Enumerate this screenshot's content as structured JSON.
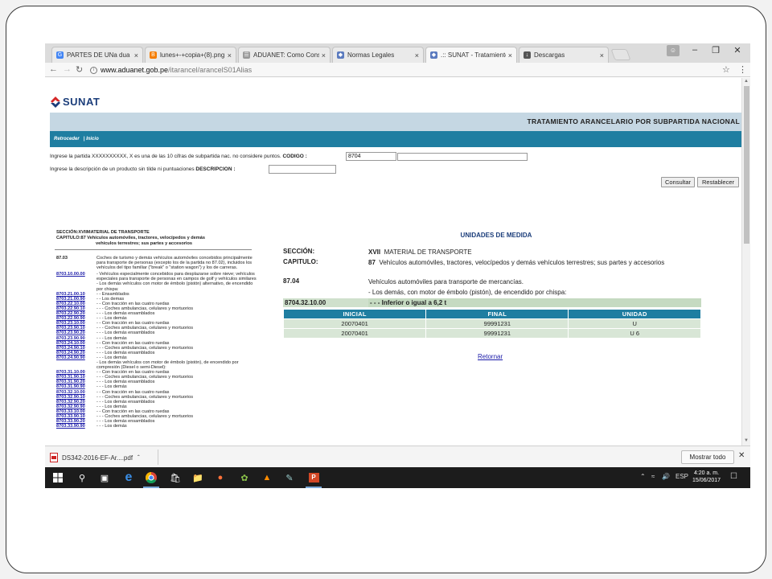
{
  "browser": {
    "tabs": [
      {
        "label": "PARTES DE UNa dua per",
        "icon": "google-icon",
        "color": "#4285f4"
      },
      {
        "label": "lunes+-+copia+(8).png",
        "icon": "blogger-icon",
        "color": "#f57d00"
      },
      {
        "label": "ADUANET: Como Conse",
        "icon": "page-icon",
        "color": "#999999"
      },
      {
        "label": "Normas Legales",
        "icon": "diamond-icon",
        "color": "#5b7bbf"
      },
      {
        "label": ".:: SUNAT - Tratamiento A",
        "icon": "diamond-icon",
        "color": "#5b7bbf"
      },
      {
        "label": "Descargas",
        "icon": "download-icon",
        "color": "#555555"
      }
    ],
    "address_host": "www.aduanet.gob.pe",
    "address_path": "/itarancel/arancelS01Alias"
  },
  "page": {
    "logo_text": "SUNAT",
    "header_title": "TRATAMIENTO ARANCELARIO POR SUBPARTIDA NACIONAL",
    "nav_back": "Retroceder",
    "nav_sep": "|",
    "nav_home": "Inicio",
    "form": {
      "codigo_hint": "Ingrese la partida XXXXXXXXXX, X es una de las 10 cifras de subpartida nac. no considere puntos.",
      "codigo_label": "CODIGO :",
      "codigo_value": "8704",
      "desc_hint": "Ingrese la descripción de un producto sin tilde ni puntuaciones",
      "desc_label": "DESCRIPCION :",
      "desc_value": "",
      "btn_consultar": "Consultar",
      "btn_restablecer": "Restablecer"
    },
    "left": {
      "seccion": "SECCIÓN:XVIIMATERIAL DE TRANSPORTE",
      "capitulo": "CAPITULO:87  Vehículos automóviles, tractores, velocípedos y demás",
      "capitulo_cont": "vehículos terrestres; sus partes y accesorios",
      "rows": [
        {
          "code": "87.03",
          "type": "bold",
          "desc": "Coches de turismo y demás vehículos automóviles concebidos principalmente para transporte de personas (excepto los de la partida no 87.02), incluidos los vehículos del tipo familiar (\"break\" o \"station wagon\") y los de carreras."
        },
        {
          "code": "8703.10.00.00",
          "type": "link",
          "desc": "- Vehículos especialmente concebidos para desplazarse sobre nieve; vehículos especiales para transporte de personas en campos de golf y vehículos similares"
        },
        {
          "code": "",
          "type": "plain",
          "desc": "- Los demás vehículos con motor de émbolo (pistón) alternativo, de encendido por chispa:"
        },
        {
          "code": "8703.21.00.10",
          "type": "link",
          "desc": "- - Ensamblados"
        },
        {
          "code": "8703.21.00.90",
          "type": "link",
          "desc": "- - Los demas"
        },
        {
          "code": "8703.22.10.00",
          "type": "link",
          "desc": "- - Con tracción en las cuatro ruedas"
        },
        {
          "code": "8703.22.90.10",
          "type": "link",
          "desc": "- - - Coches ambulancias, celulares y mortuorios"
        },
        {
          "code": "8703.22.90.20",
          "type": "link",
          "desc": "- - - Los demás ensamblados"
        },
        {
          "code": "8703.22.90.90",
          "type": "link",
          "desc": "- - - Los demás"
        },
        {
          "code": "8703.23.10.00",
          "type": "link",
          "desc": "- - Con tracción en las cuatro ruedas"
        },
        {
          "code": "8703.23.90.10",
          "type": "link",
          "desc": "- - - Coches ambulancias, celulares y mortuorios"
        },
        {
          "code": "8703.23.90.20",
          "type": "link",
          "desc": "- - - Los demás ensamblados"
        },
        {
          "code": "8703.23.90.90",
          "type": "link",
          "desc": "- - - Los demás"
        },
        {
          "code": "8703.24.10.00",
          "type": "link",
          "desc": "- - Con tracción en las cuatro ruedas"
        },
        {
          "code": "8703.24.90.10",
          "type": "link",
          "desc": "- - - Coches ambulancias, celulares y mortuorios"
        },
        {
          "code": "8703.24.90.20",
          "type": "link",
          "desc": "- - - Los demás ensamblados"
        },
        {
          "code": "8703.24.90.90",
          "type": "link",
          "desc": "- - - Los demás"
        },
        {
          "code": "",
          "type": "plain",
          "desc": "- Los demás vehículos con motor de émbolo (pistón), de encendido por compresión (Diesel o semi-Diesel):"
        },
        {
          "code": "8703.31.10.00",
          "type": "link",
          "desc": "- - Con tracción en las cuatro ruedas"
        },
        {
          "code": "8703.31.90.10",
          "type": "link",
          "desc": "- - - Coches ambulancias, celulares y mortuorios"
        },
        {
          "code": "8703.31.90.20",
          "type": "link",
          "desc": "- - - Los demás ensamblados"
        },
        {
          "code": "8703.31.90.90",
          "type": "link",
          "desc": "- - - Los demás"
        },
        {
          "code": "8703.32.10.00",
          "type": "link",
          "desc": "- - Con tracción en las cuatro ruedas"
        },
        {
          "code": "8703.32.90.10",
          "type": "link",
          "desc": "- - - Coches ambulancias, celulares y mortuorios"
        },
        {
          "code": "8703.32.90.20",
          "type": "link",
          "desc": "- - - Los demás ensamblados"
        },
        {
          "code": "8703.32.90.90",
          "type": "link",
          "desc": "- - - Los demás"
        },
        {
          "code": "8703.33.10.00",
          "type": "link",
          "desc": "- - Con tracción en las cuatro ruedas"
        },
        {
          "code": "8703.33.90.10",
          "type": "link",
          "desc": "- - - Coches ambulancias, celulares y mortuorios"
        },
        {
          "code": "8703.33.90.20",
          "type": "link",
          "desc": "- - - Los demás ensamblados"
        },
        {
          "code": "8703.33.90.90",
          "type": "link",
          "desc": "- - - Los demás"
        }
      ]
    },
    "right": {
      "title": "UNIDADES DE MEDIDA",
      "seccion_label": "SECCIÓN:",
      "seccion_num": "XVII",
      "seccion_text": "MATERIAL DE TRANSPORTE",
      "capitulo_label": "CAPITULO:",
      "capitulo_num": "87",
      "capitulo_text": "Vehículos automóviles, tractores, velocípedos y demás vehículos terrestres; sus partes y accesorios",
      "partida_code": "87.04",
      "partida_text": "Vehículos automóviles para transporte de mercancías.",
      "partida_sub": "- Los demás, con motor de émbolo (pistón), de encendido por chispa:",
      "sub_code": "8704.32.10.00",
      "sub_text": "- - - Inferior o igual a 6,2 t",
      "table_headers": [
        "INICIAL",
        "FINAL",
        "UNIDAD"
      ],
      "table_rows": [
        [
          "20070401",
          "99991231",
          "U"
        ],
        [
          "20070401",
          "99991231",
          "U 6"
        ]
      ],
      "retornar": "Retornar"
    }
  },
  "downloads": {
    "file": "DS342-2016-EF-Ar....pdf",
    "show_all": "Mostrar todo"
  },
  "taskbar": {
    "lang": "ESP",
    "time": "4:20 a. m.",
    "date": "15/06/2017"
  },
  "colors": {
    "header_blue": "#1f7ea1",
    "title_band": "#c5d7e3",
    "row_green": "#d8e6d6",
    "logo_red": "#d62828",
    "logo_navy": "#1b3d7a"
  }
}
